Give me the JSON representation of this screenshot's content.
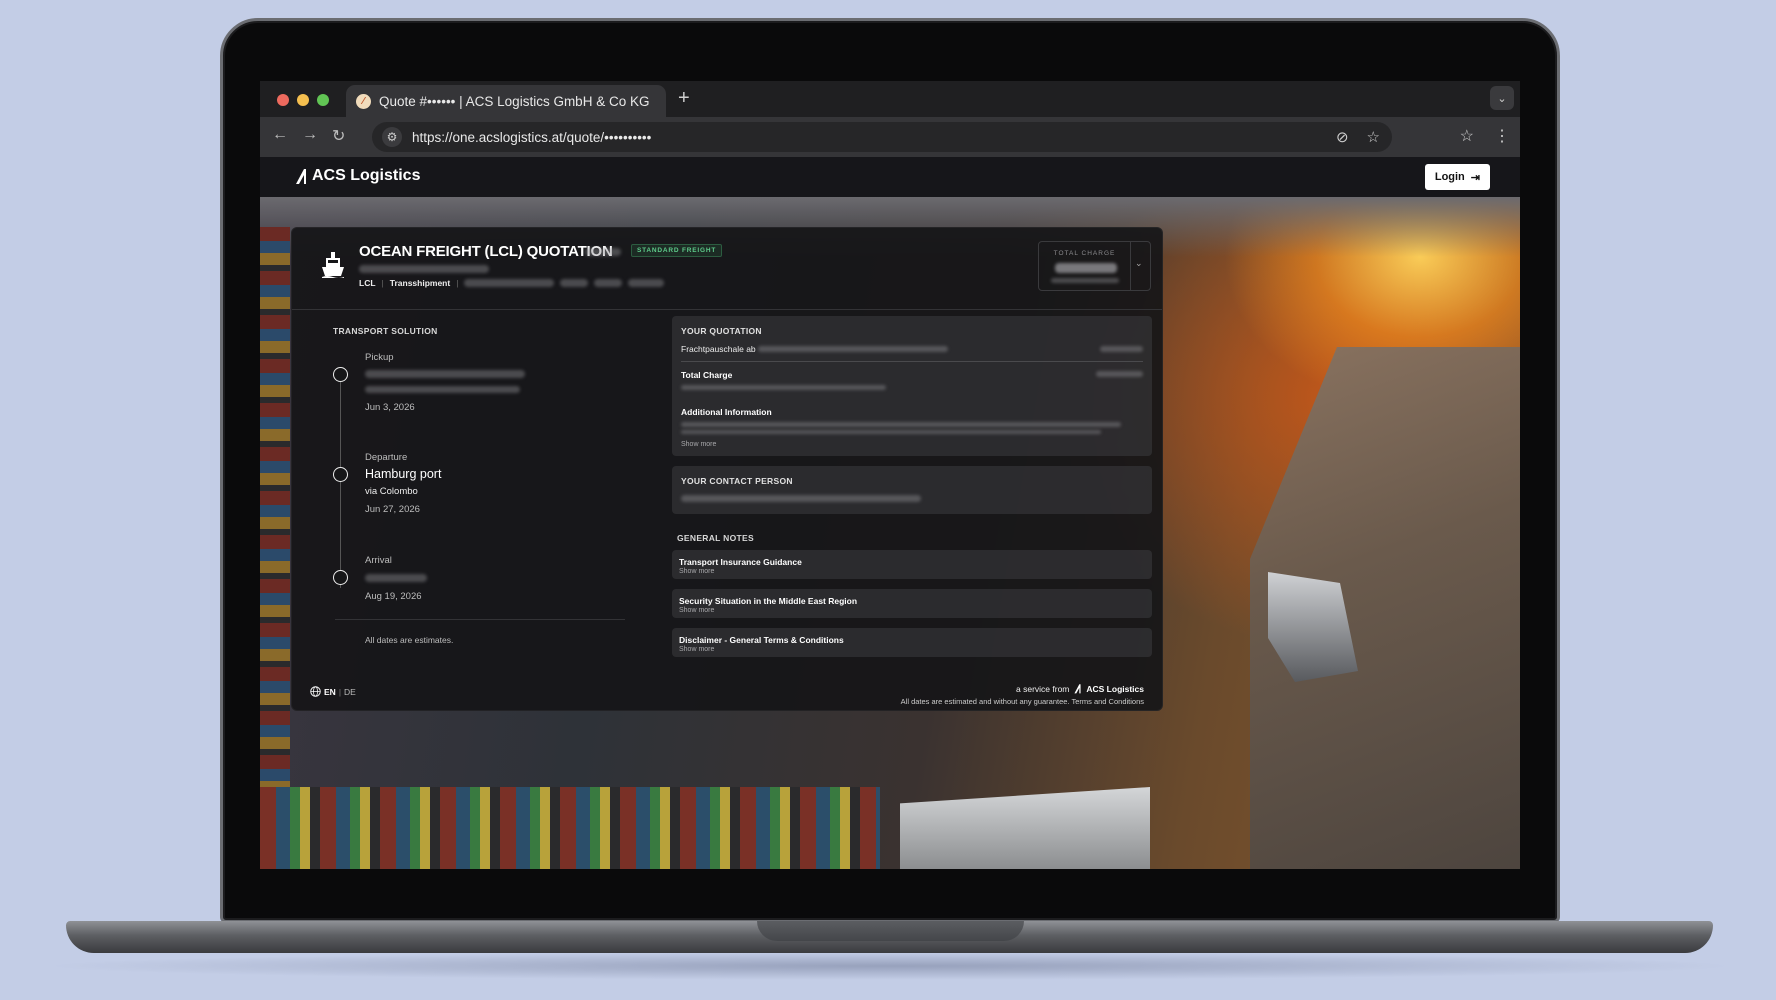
{
  "browser": {
    "tab_title": "Quote #•••••• | ACS Logistics GmbH & Co KG",
    "new_tab": "+",
    "url": "https://one.acslogistics.at/quote/••••••••••"
  },
  "site": {
    "logo_text": "ACS Logistics",
    "login_label": "Login"
  },
  "quote": {
    "title": "OCEAN FREIGHT (LCL) QUOTATION",
    "badge": "STANDARD FREIGHT",
    "meta": [
      "LCL",
      "Transshipment"
    ],
    "total_label": "TOTAL CHARGE"
  },
  "transport": {
    "section_label": "TRANSPORT SOLUTION",
    "stops": [
      {
        "label": "Pickup",
        "main": "",
        "sub": "",
        "date": "Jun 3, 2026"
      },
      {
        "label": "Departure",
        "main": "Hamburg port",
        "sub": "via Colombo",
        "date": "Jun 27, 2026"
      },
      {
        "label": "Arrival",
        "main": "",
        "sub": "",
        "date": "Aug 19, 2026"
      }
    ],
    "estimates_note": "All dates are estimates."
  },
  "quotation": {
    "section_label": "YOUR QUOTATION",
    "line_item": "Frachtpauschale ab",
    "total_label": "Total Charge",
    "additional_label": "Additional Information",
    "show_more": "Show more"
  },
  "contact": {
    "section_label": "YOUR CONTACT PERSON"
  },
  "notes": {
    "section_label": "GENERAL NOTES",
    "items": [
      {
        "title": "Transport Insurance Guidance",
        "more": "Show more"
      },
      {
        "title": "Security Situation in the Middle East Region",
        "more": "Show more"
      },
      {
        "title": "Disclaimer - General Terms & Conditions",
        "more": "Show more"
      }
    ]
  },
  "footer": {
    "lang_en": "EN",
    "lang_sep": "|",
    "lang_de": "DE",
    "service_prefix": "a service from",
    "service_brand": "ACS Logistics",
    "disclaimer": "All dates are estimated and without any guarantee. Terms and Conditions"
  },
  "colors": {
    "accent_green": "#5ecb8a",
    "background": "#c3cde6"
  }
}
